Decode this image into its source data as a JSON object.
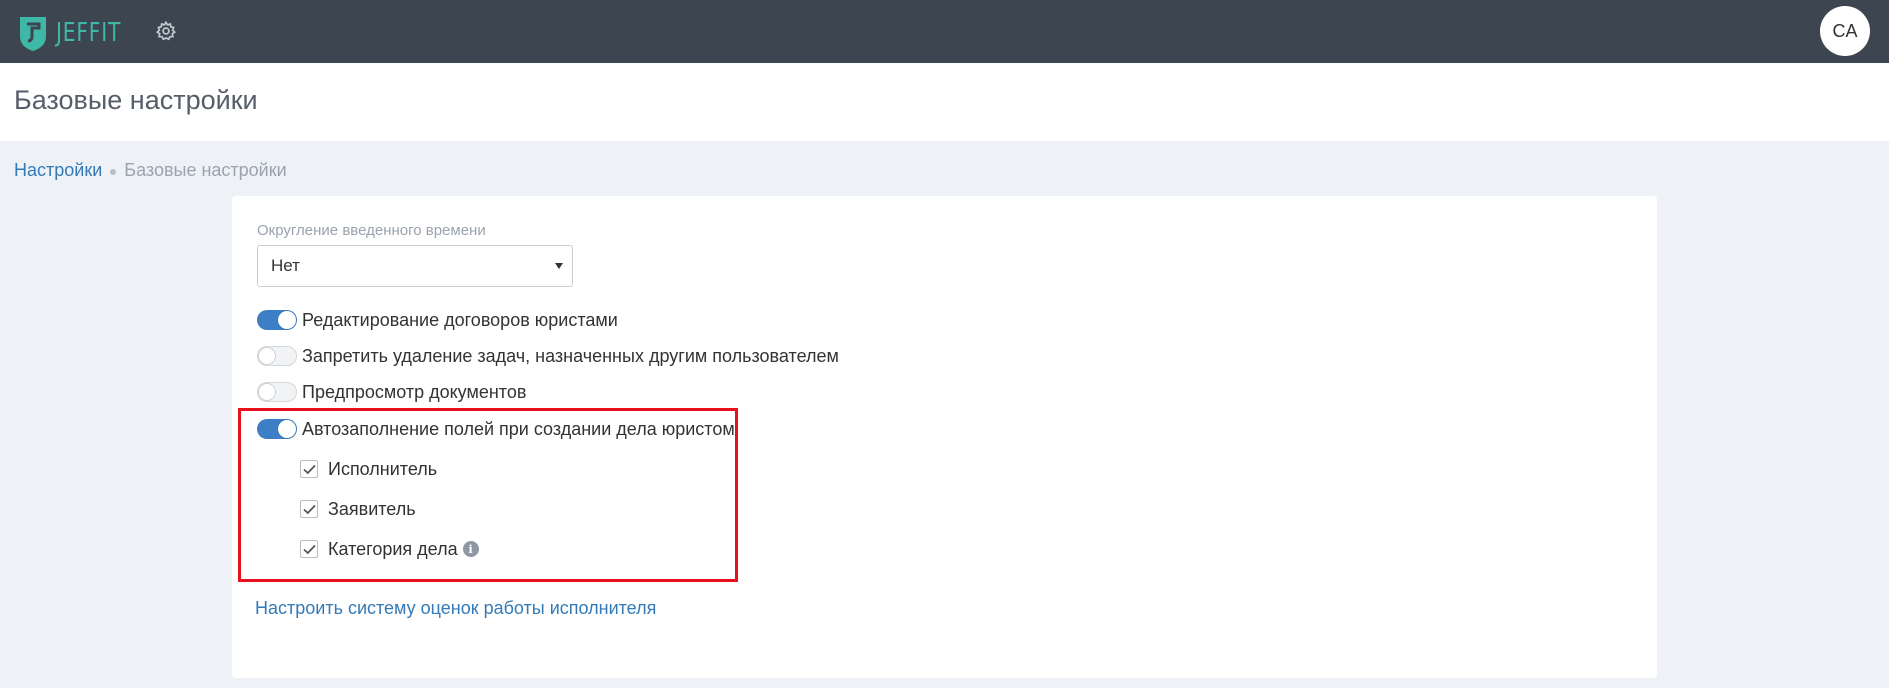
{
  "app": {
    "logo_text": "JEFFIT",
    "logo_icon": "jeffit-shield-icon",
    "settings_icon": "gear-icon",
    "avatar_initials": "CA"
  },
  "page": {
    "title": "Базовые настройки"
  },
  "breadcrumb": {
    "parent": "Настройки",
    "current": "Базовые настройки"
  },
  "form": {
    "rounding_label": "Округление введенного времени",
    "rounding_value": "Нет",
    "toggles": [
      {
        "label": "Редактирование договоров юристами",
        "on": true
      },
      {
        "label": "Запретить удаление задач, назначенных другим пользователем",
        "on": false
      },
      {
        "label": "Предпросмотр документов",
        "on": false
      },
      {
        "label": "Автозаполнение полей при создании дела юристом",
        "on": true
      }
    ],
    "autofill_options": [
      {
        "label": "Исполнитель",
        "checked": true
      },
      {
        "label": "Заявитель",
        "checked": true
      },
      {
        "label": "Категория дела",
        "checked": true,
        "info_icon": "info-icon"
      }
    ],
    "rating_link": "Настроить систему оценок работы исполнителя"
  },
  "colors": {
    "topbar": "#3d4550",
    "accent": "#3d7fc4",
    "link": "#337ab7",
    "highlight": "#e8101c",
    "logo": "#3fb8a8"
  }
}
